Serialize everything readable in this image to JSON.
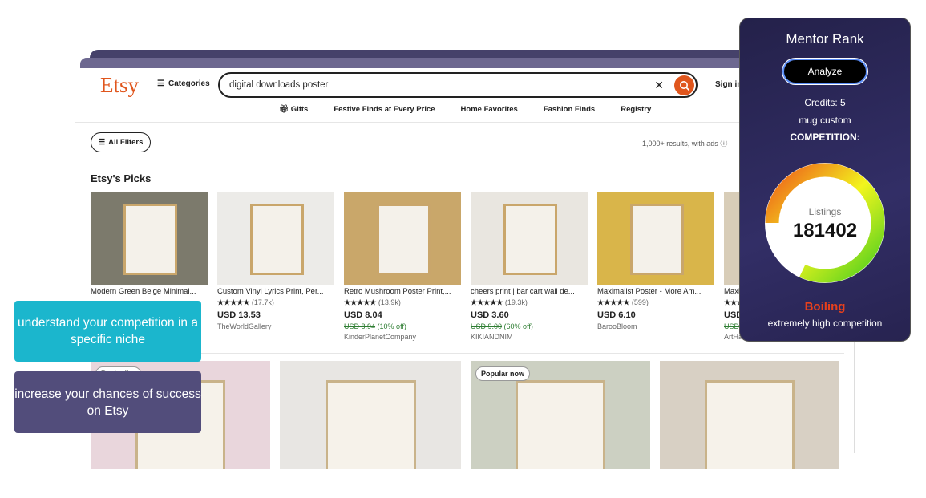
{
  "header": {
    "logo": "Etsy",
    "categories": "Categories",
    "search_value": "digital downloads poster",
    "sign_in": "Sign in"
  },
  "nav": [
    {
      "label": "Gifts",
      "icon": "gift-icon"
    },
    {
      "label": "Festive Finds at Every Price"
    },
    {
      "label": "Home Favorites"
    },
    {
      "label": "Fashion Finds"
    },
    {
      "label": "Registry"
    }
  ],
  "toolbar": {
    "all_filters": "All Filters",
    "results": "1,000+ results, with ads"
  },
  "picks": {
    "title": "Etsy's Picks",
    "items": [
      {
        "title": "Modern Green Beige Minimal...",
        "rating": "",
        "reviews": "",
        "price": "",
        "orig": "",
        "off": "",
        "shop": "",
        "color": "#7c7a6c"
      },
      {
        "title": "Custom Vinyl Lyrics Print, Per...",
        "rating": "★★★★★",
        "reviews": "(17.7k)",
        "price": "USD 13.53",
        "orig": "",
        "off": "",
        "shop": "TheWorldGallery",
        "color": "#ecebe8"
      },
      {
        "title": "Retro Mushroom Poster Print,...",
        "rating": "★★★★★",
        "reviews": "(13.9k)",
        "price": "USD 8.04",
        "orig": "USD 8.94",
        "off": "(10% off)",
        "shop": "KinderPlanetCompany",
        "color": "#c9a76a"
      },
      {
        "title": "cheers print | bar cart wall de...",
        "rating": "★★★★★",
        "reviews": "(19.3k)",
        "price": "USD 3.60",
        "orig": "USD 9.00",
        "off": "(60% off)",
        "shop": "KIKIANDNIM",
        "color": "#e9e6e0"
      },
      {
        "title": "Maximalist Poster - More Am...",
        "rating": "★★★★★",
        "reviews": "(599)",
        "price": "USD 6.10",
        "orig": "",
        "off": "",
        "shop": "BarooBloom",
        "color": "#d9b54a"
      },
      {
        "title": "Maximalist...",
        "rating": "★★★★★",
        "reviews": "",
        "price": "USD",
        "orig": "USD",
        "off": "",
        "shop": "ArtHa",
        "color": "#d8cdb8"
      }
    ]
  },
  "grid": [
    {
      "badge": "Bestseller",
      "color": "#e9d6dc"
    },
    {
      "badge": "",
      "color": "#e8e6e3"
    },
    {
      "badge": "Popular now",
      "color": "#ccd0c2"
    },
    {
      "badge": "",
      "color": "#d8d0c4"
    }
  ],
  "overlays": {
    "top": "understand your competition in a specific niche",
    "bottom": "increase your chances of success on Etsy"
  },
  "panel": {
    "title": "Mentor Rank",
    "analyze": "Analyze",
    "credits": "Credits: 5",
    "keyword": "mug custom",
    "competition_label": "COMPETITION:",
    "listings_label": "Listings",
    "listings": "181402",
    "level": "Boiling",
    "level_desc": "extremely high competition",
    "gauge_fill_percent": 82
  },
  "colors": {
    "etsy_orange": "#e0561d",
    "cyan": "#1bb6cd",
    "purple": "#524d7b",
    "boiling": "#e8401c"
  }
}
